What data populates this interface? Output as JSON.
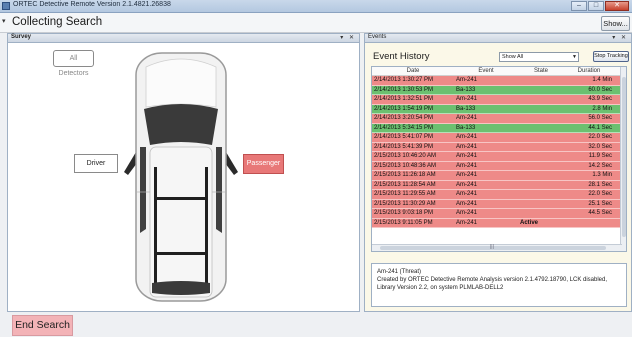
{
  "window": {
    "title": "ORTEC Detective Remote Version 2.1.4821.26838",
    "controls": [
      "–",
      "□",
      "✕"
    ]
  },
  "header": {
    "title": "Collecting Search",
    "show_label": "Show..."
  },
  "survey": {
    "tab_label": "Survey",
    "tab_controls": "▾ ✕",
    "all_detectors_label": "All Detectors",
    "driver_label": "Driver",
    "passenger_label": "Passenger"
  },
  "events": {
    "tab_label": "Events",
    "tab_controls": "▾ ✕",
    "heading": "Event History",
    "filter_value": "Show All",
    "stop_label": "Stop Tracking",
    "columns": [
      "Date",
      "Event",
      "State",
      "Duration"
    ],
    "rows": [
      {
        "date": "2/14/2013 1:30:27 PM",
        "event": "Am-241",
        "state": "",
        "duration": "1.4 Min",
        "status": "threat"
      },
      {
        "date": "2/14/2013 1:30:53 PM",
        "event": "Ba-133",
        "state": "",
        "duration": "60.0 Sec",
        "status": "safe"
      },
      {
        "date": "2/14/2013 1:32:51 PM",
        "event": "Am-241",
        "state": "",
        "duration": "43.9 Sec",
        "status": "threat"
      },
      {
        "date": "2/14/2013 1:54:19 PM",
        "event": "Ba-133",
        "state": "",
        "duration": "2.8 Min",
        "status": "safe"
      },
      {
        "date": "2/14/2013 3:20:54 PM",
        "event": "Am-241",
        "state": "",
        "duration": "56.0 Sec",
        "status": "threat"
      },
      {
        "date": "2/14/2013 5:34:15 PM",
        "event": "Ba-133",
        "state": "",
        "duration": "44.1 Sec",
        "status": "safe"
      },
      {
        "date": "2/14/2013 5:41:07 PM",
        "event": "Am-241",
        "state": "",
        "duration": "22.0 Sec",
        "status": "threat"
      },
      {
        "date": "2/14/2013 5:41:39 PM",
        "event": "Am-241",
        "state": "",
        "duration": "32.0 Sec",
        "status": "threat"
      },
      {
        "date": "2/15/2013 10:46:20 AM",
        "event": "Am-241",
        "state": "",
        "duration": "11.9 Sec",
        "status": "threat"
      },
      {
        "date": "2/15/2013 10:48:36 AM",
        "event": "Am-241",
        "state": "",
        "duration": "14.2 Sec",
        "status": "threat"
      },
      {
        "date": "2/15/2013 11:26:18 AM",
        "event": "Am-241",
        "state": "",
        "duration": "1.3 Min",
        "status": "threat"
      },
      {
        "date": "2/15/2013 11:28:54 AM",
        "event": "Am-241",
        "state": "",
        "duration": "28.1 Sec",
        "status": "threat"
      },
      {
        "date": "2/15/2013 11:29:55 AM",
        "event": "Am-241",
        "state": "",
        "duration": "22.0 Sec",
        "status": "threat"
      },
      {
        "date": "2/15/2013 11:30:29 AM",
        "event": "Am-241",
        "state": "",
        "duration": "25.1 Sec",
        "status": "threat"
      },
      {
        "date": "2/15/2013 9:03:18 PM",
        "event": "Am-241",
        "state": "",
        "duration": "44.5 Sec",
        "status": "threat"
      },
      {
        "date": "2/15/2013 9:11:05 PM",
        "event": "Am-241",
        "state": "Active",
        "duration": "",
        "status": "threat"
      }
    ],
    "scroll_grip": "|||",
    "detail": {
      "line1": "Am-241 (Threat)",
      "line2": "Created by ORTEC Detective Remote Analysis version 2.1.4792.18790, LCK disabled,",
      "line3": "Library Version 2.2, on system PLMLAB-DELL2"
    }
  },
  "footer": {
    "end_search_label": "End Search"
  },
  "colors": {
    "threat_row": "#ee8a88",
    "safe_row": "#6cc070",
    "passenger": "#e87878",
    "end_button": "#f3b3b7"
  }
}
